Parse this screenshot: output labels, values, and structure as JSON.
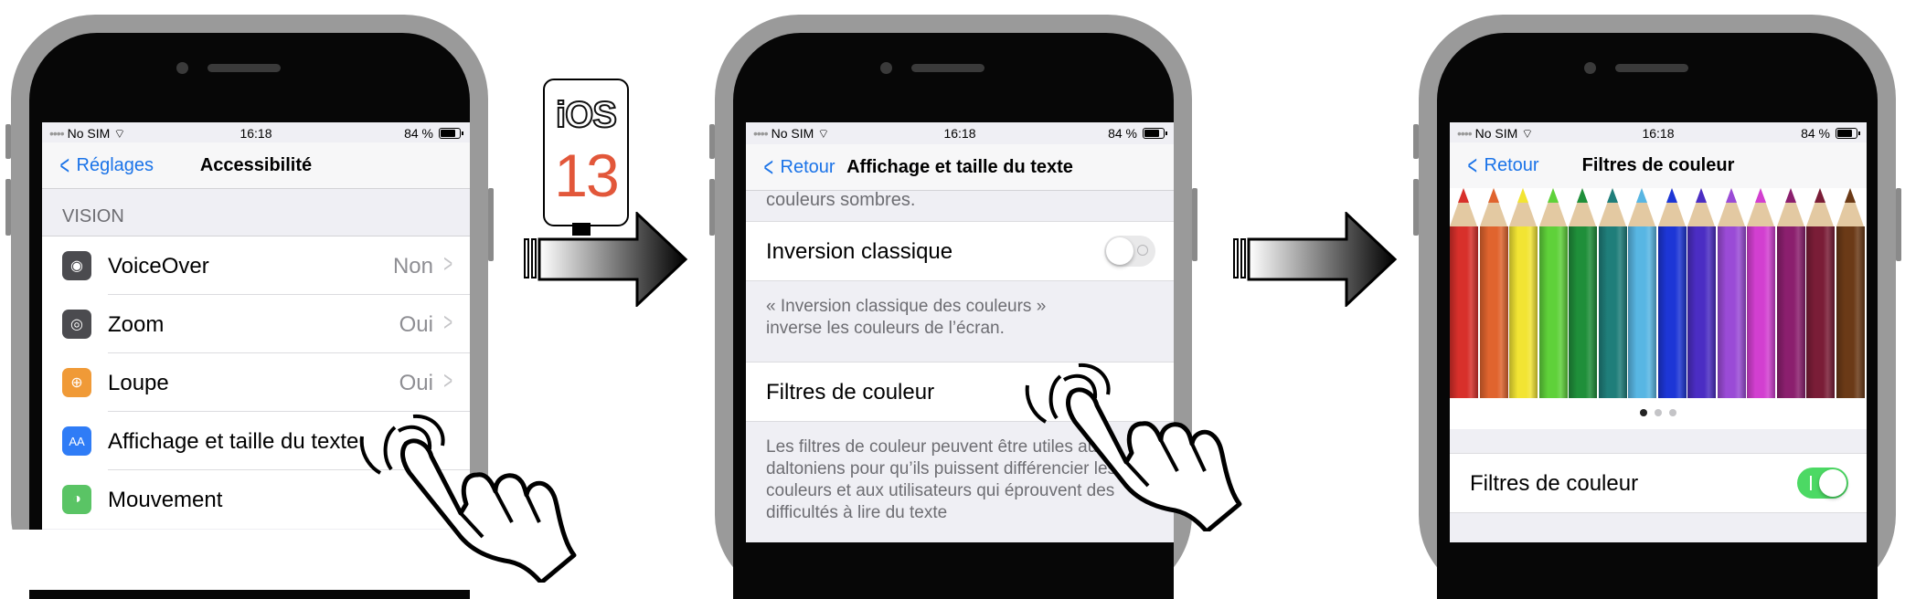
{
  "ios_badge": {
    "line1": "iOS",
    "line2": "13"
  },
  "status": {
    "carrier": "No SIM",
    "time": "16:18",
    "battery": "84 %"
  },
  "screen1": {
    "nav": {
      "back": "Réglages",
      "title": "Accessibilité"
    },
    "section": "VISION",
    "rows": [
      {
        "label": "VoiceOver",
        "value": "Non",
        "icon_color": "#4b4b4f",
        "icon": "voiceover-icon"
      },
      {
        "label": "Zoom",
        "value": "Oui",
        "icon_color": "#4b4b4f",
        "icon": "zoom-icon"
      },
      {
        "label": "Loupe",
        "value": "Oui",
        "icon_color": "#f09a37",
        "icon": "magnifier-icon"
      },
      {
        "label": "Affichage et taille du texte",
        "value": "",
        "icon_color": "#2f7cf6",
        "icon": "text-size-icon",
        "icon_text": "AA"
      },
      {
        "label": "Mouvement",
        "value": "",
        "icon_color": "#5ac465",
        "icon": "motion-icon"
      }
    ]
  },
  "screen2": {
    "nav": {
      "back": "Retour",
      "title": "Affichage et taille du texte"
    },
    "top_footer": "couleurs sombres.",
    "inversion": {
      "label": "Inversion classique",
      "toggle": "off"
    },
    "inversion_footer": "« Inversion classique des couleurs » inverse les couleurs de l’écran.",
    "filters_label": "Filtres de couleur",
    "filters_footer": "Les filtres de couleur peuvent être utiles aux daltoniens pour qu’ils puissent différencier les couleurs et aux utilisateurs qui éprouvent des difficultés à lire du texte"
  },
  "screen3": {
    "nav": {
      "back": "Retour",
      "title": "Filtres de couleur"
    },
    "pencil_colors": [
      "#d8302b",
      "#e0642e",
      "#f2e433",
      "#5fd13a",
      "#1f8f3a",
      "#1f7e7a",
      "#58b6e3",
      "#1d36d6",
      "#4b2dc3",
      "#9a4bd6",
      "#d23fd0",
      "#8b1f6e",
      "#7a1d37",
      "#6b3a17"
    ],
    "page_dots": 3,
    "toggle": {
      "label": "Filtres de couleur",
      "state": "on"
    }
  },
  "colors": {
    "ios_blue": "#1a73e8",
    "toggle_on": "#4cd964",
    "toggle_off": "#e9e9ea"
  }
}
